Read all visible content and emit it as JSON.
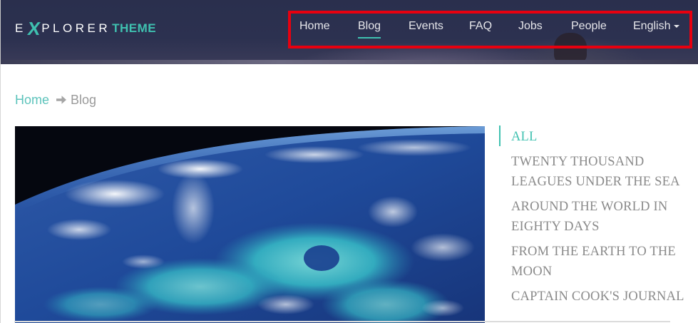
{
  "logo": {
    "prefix": "E",
    "x": "X",
    "word": "PLORER",
    "theme": "THEME"
  },
  "nav": {
    "items": [
      {
        "label": "Home"
      },
      {
        "label": "Blog",
        "active": true
      },
      {
        "label": "Events"
      },
      {
        "label": "FAQ"
      },
      {
        "label": "Jobs"
      },
      {
        "label": "People"
      }
    ],
    "language": "English"
  },
  "breadcrumb": {
    "home": "Home",
    "current": "Blog"
  },
  "categories": [
    {
      "label": "ALL",
      "active": true
    },
    {
      "line1": "TWENTY THOUSAND",
      "line2": "LEAGUES UNDER THE SEA"
    },
    {
      "line1": "AROUND THE WORLD IN",
      "line2": "EIGHTY DAYS"
    },
    {
      "line1": "FROM THE EARTH TO THE",
      "line2": "MOON"
    },
    {
      "line1": "CAPTAIN COOK'S JOURNAL"
    }
  ],
  "colors": {
    "accent": "#3fc1b0",
    "highlight_box": "#e8000f",
    "header_bg": "#2c3150"
  },
  "icons": {
    "breadcrumb_separator": "arrow-right-icon",
    "language_dropdown": "caret-down-icon"
  }
}
